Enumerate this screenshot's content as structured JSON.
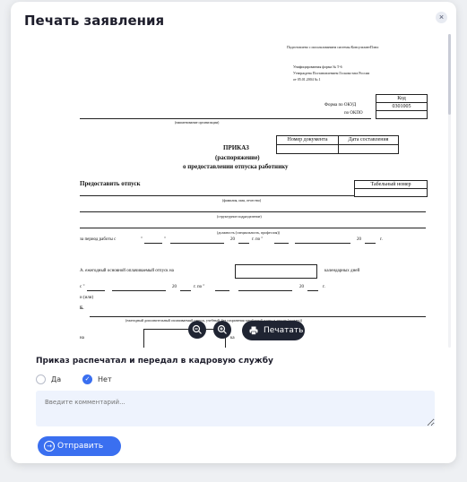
{
  "modal": {
    "title": "Печать заявления",
    "close_glyph": "×"
  },
  "document": {
    "prepared_note": "Подготовлено с использованием системы КонсультантПлюс",
    "unified_form": "Унифицированная форма № Т-6",
    "approved": "Утверждена Постановлением Госкомстата России",
    "approved_date": "от 05.01.2004 № 1",
    "code_header": "Код",
    "okud_label": "Форма по ОКУД",
    "okud_code": "0301005",
    "okpo_label": "по ОКПО",
    "org_caption": "(наименование организации)",
    "doc_number_header": "Номер документа",
    "doc_date_header": "Дата составления",
    "order_title": "ПРИКАЗ",
    "order_subtitle": "(распоряжение)",
    "order_subject": "о предоставлении отпуска работнику",
    "grant_leave": "Предоставить отпуск",
    "tab_number_header": "Табельный номер",
    "fio_caption": "(фамилия, имя, отчество)",
    "dept_caption": "(структурное подразделение)",
    "position_caption": "(должность (специальность, профессия))",
    "period_label": "за период работы с",
    "period_quote_open": "\"",
    "period_quote_close": "\"",
    "year_prefix_1": "20",
    "year_suffix_1": "г. по \"",
    "year_prefix_2": "20",
    "year_suffix_2": "г.",
    "section_a": "А. ежегодный основной оплачиваемый отпуск на",
    "calendar_days": "календарных дней",
    "from_label": "с \"",
    "year_prefix_3": "20",
    "year_mid": "г. по \"",
    "year_prefix_4": "20",
    "year_end": "г.",
    "and_or": "и (или)",
    "section_b": "Б.",
    "additional_caption": "(ежегодный дополнительный оплачиваемый отпуск, учебный, без сохранения заработной платы и другие (указать))",
    "on_label": "на",
    "calendar_short": "ка"
  },
  "toolbar": {
    "zoom_out_glyph": "−",
    "zoom_in_glyph": "+",
    "print_label": "Печатать"
  },
  "form": {
    "question": "Приказ распечатал и передал в кадровую службу",
    "option_yes": "Да",
    "option_no": "Нет",
    "selected": "Нет",
    "comment_placeholder": "Введите комментарий...",
    "submit_label": "Отправить",
    "submit_glyph": "→"
  }
}
